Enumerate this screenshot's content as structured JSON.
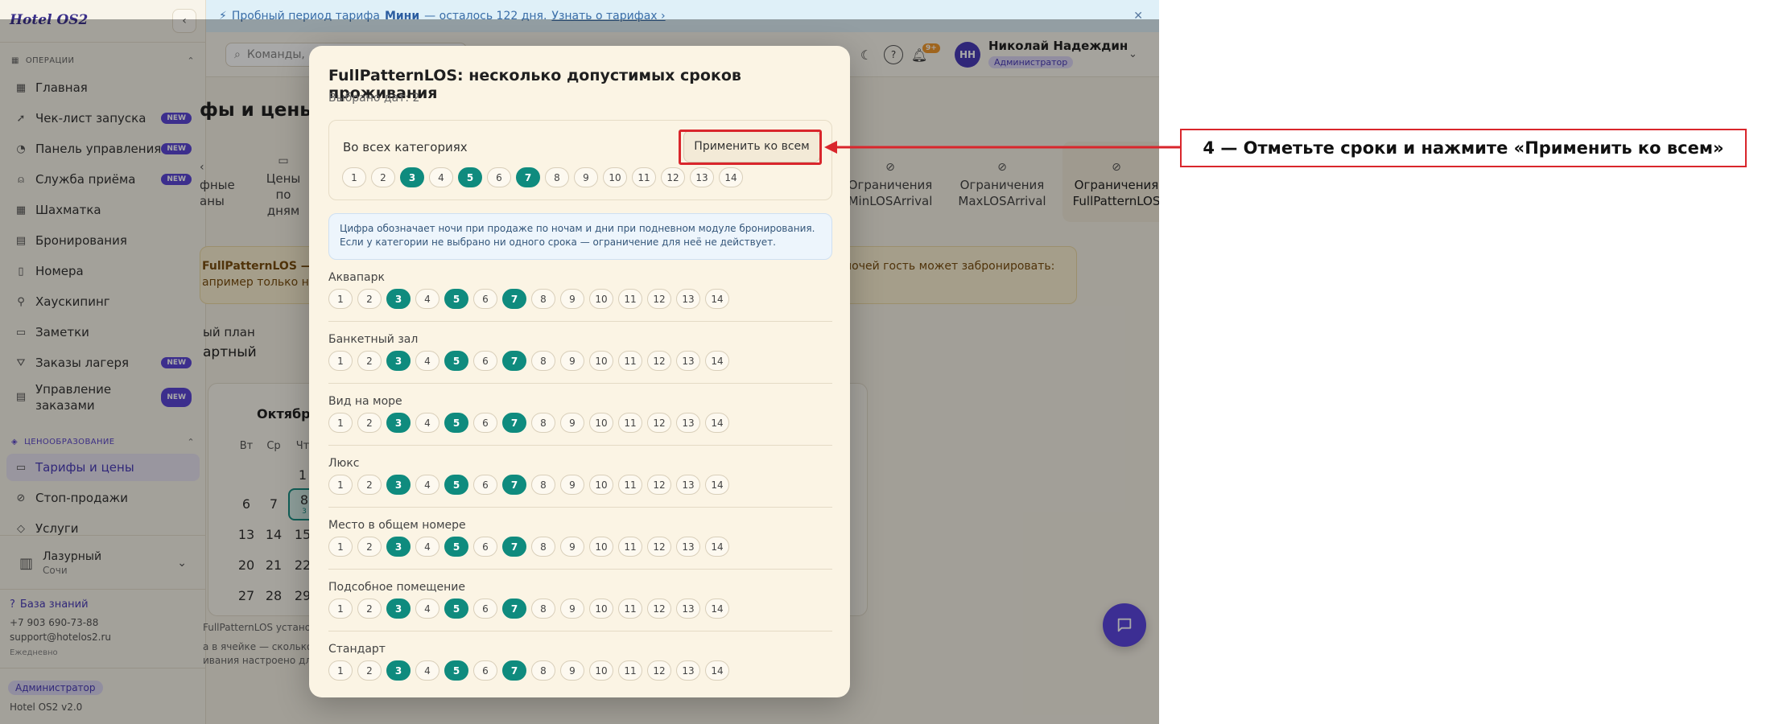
{
  "sidebar": {
    "logo": "Hotel OS2",
    "sections": {
      "operations": "ОПЕРАЦИИ",
      "pricing": "ЦЕНООБРАЗОВАНИЕ"
    },
    "items": [
      {
        "label": "Главная",
        "icon": "grid-icon"
      },
      {
        "label": "Чек-лист запуска",
        "icon": "rocket-icon",
        "badge": "NEW"
      },
      {
        "label": "Панель управления",
        "icon": "gauge-icon",
        "badge": "NEW"
      },
      {
        "label": "Служба приёма",
        "icon": "bell-icon",
        "badge": "NEW"
      },
      {
        "label": "Шахматка",
        "icon": "table-icon"
      },
      {
        "label": "Бронирования",
        "icon": "document-icon"
      },
      {
        "label": "Номера",
        "icon": "door-icon"
      },
      {
        "label": "Хаускипинг",
        "icon": "broom-icon"
      },
      {
        "label": "Заметки",
        "icon": "note-icon"
      },
      {
        "label": "Заказы лагеря",
        "icon": "tent-icon",
        "badge": "NEW"
      },
      {
        "label": "Управление заказами",
        "icon": "receipt-icon",
        "badge": "NEW"
      }
    ],
    "pricing_items": [
      {
        "label": "Тарифы и цены",
        "icon": "card-icon"
      },
      {
        "label": "Стоп-продажи",
        "icon": "ban-icon"
      },
      {
        "label": "Услуги",
        "icon": "tag-icon"
      }
    ],
    "hotel": {
      "name": "Лазурный",
      "city": "Сочи"
    },
    "knowledge_base": "База знаний",
    "phone": "+7 903 690-73-88",
    "email": "support@hotelos2.ru",
    "schedule": "Ежедневно",
    "role": "Администратор",
    "version": "Hotel OS2 v2.0"
  },
  "trial": {
    "prefix": "Пробный период тарифа",
    "plan": "Мини",
    "remaining": "— осталось 122 дня.",
    "link": "Узнать о тарифах ›"
  },
  "header": {
    "search_placeholder": "Команды,",
    "notifications": "9+",
    "user_initials": "НН",
    "user_name": "Николай Надеждин",
    "user_role": "Администратор"
  },
  "page": {
    "title": "фы и цены",
    "tabs": [
      "фные\nаны",
      "Цены\nпо\nдням",
      "Ограничения\nMinLOSArrival",
      "Ограничения\nMaxLOSArrival",
      "Ограничения\nFullPatternLOS"
    ],
    "banner_l1": "FullPatternLOS — н",
    "banner_l2": "апример только н",
    "banner_r1": "ночей гость может забронировать:",
    "plan_label": "ый план",
    "plan_value": "артный",
    "calendar": {
      "month": "Октябрь",
      "dow": [
        "Вт",
        "Ср",
        "Чт"
      ],
      "rows": [
        [
          "",
          "",
          "1"
        ],
        [
          "6",
          "7",
          "8"
        ],
        [
          "13",
          "14",
          "15"
        ],
        [
          "20",
          "21",
          "22"
        ],
        [
          "27",
          "28",
          "29"
        ]
      ],
      "selected_mark": "3"
    },
    "note1": "FullPatternLOS установ",
    "note2": "а в ячейке — сколько",
    "note3": "ивания настроено дл"
  },
  "modal": {
    "title": "FullPatternLOS: несколько допустимых сроков проживания",
    "subtitle": "Выбрано дат: 2",
    "all_label": "Во всех категориях",
    "apply_button": "Применить ко всем",
    "hint": "Цифра обозначает ночи при продаже по ночам и дни при подневном модуле бронирования. Если у категории не выбрано ни одного срока — ограничение для неё не действует.",
    "stay_options": [
      "1",
      "2",
      "3",
      "4",
      "5",
      "6",
      "7",
      "8",
      "9",
      "10",
      "11",
      "12",
      "13",
      "14"
    ],
    "selected": [
      "3",
      "5",
      "7"
    ],
    "categories": [
      "Аквапарк",
      "Банкетный зал",
      "Вид на море",
      "Люкс",
      "Место в общем номере",
      "Подсобное помещение",
      "Стандарт"
    ]
  },
  "annotation": {
    "text": "4 — Отметьте сроки и нажмите «Применить ко всем»",
    "color": "#d9262c"
  }
}
